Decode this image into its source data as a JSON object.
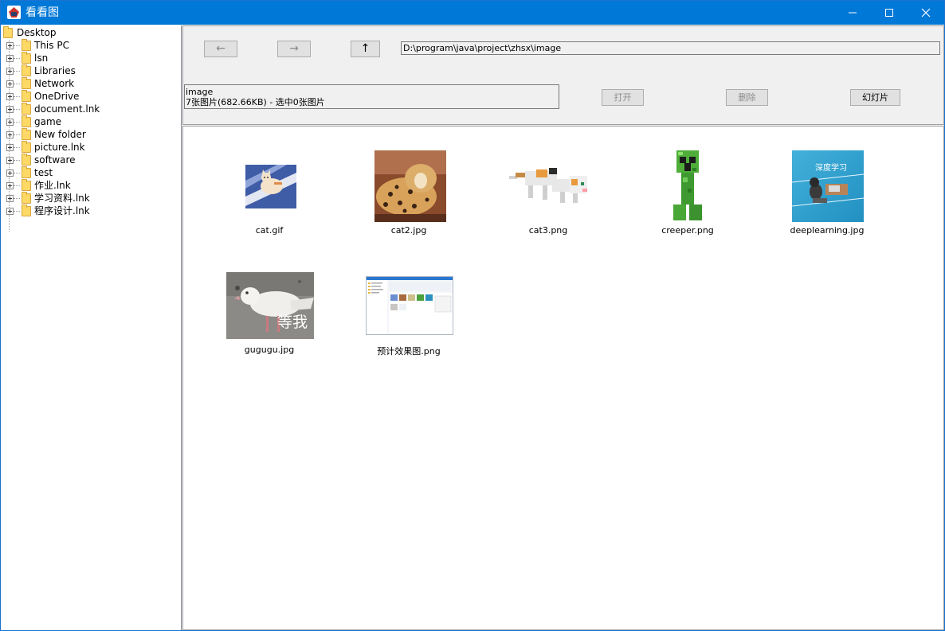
{
  "window": {
    "title": "看看图",
    "minimize_icon": "minimize-icon",
    "maximize_icon": "maximize-icon",
    "close_icon": "close-icon"
  },
  "tree": {
    "root": "Desktop",
    "items": [
      {
        "label": "This PC"
      },
      {
        "label": "lsn"
      },
      {
        "label": "Libraries"
      },
      {
        "label": "Network"
      },
      {
        "label": "OneDrive"
      },
      {
        "label": "document.lnk"
      },
      {
        "label": "game"
      },
      {
        "label": "New folder"
      },
      {
        "label": "picture.lnk"
      },
      {
        "label": "software"
      },
      {
        "label": "test"
      },
      {
        "label": "作业.lnk"
      },
      {
        "label": "学习资料.lnk"
      },
      {
        "label": "程序设计.lnk"
      }
    ]
  },
  "toolbar": {
    "back_label": "←",
    "forward_label": "→",
    "up_label": "↑",
    "path": "D:\\program\\java\\project\\zhsx\\image",
    "folder_name": "image",
    "summary": "7张图片(682.66KB) - 选中0张图片",
    "open_label": "打开",
    "delete_label": "删除",
    "slideshow_label": "幻灯片"
  },
  "images": [
    {
      "name": "cat.gif"
    },
    {
      "name": "cat2.jpg"
    },
    {
      "name": "cat3.png"
    },
    {
      "name": "creeper.png"
    },
    {
      "name": "deeplearning.jpg",
      "overlay_text": "深度学习"
    },
    {
      "name": "gugugu.jpg",
      "overlay_text": "等我"
    },
    {
      "name": "预计效果图.png"
    }
  ],
  "colors": {
    "titlebar": "#0078d7",
    "window_bg": "#f0f0f0",
    "folder": "#ffd966"
  }
}
